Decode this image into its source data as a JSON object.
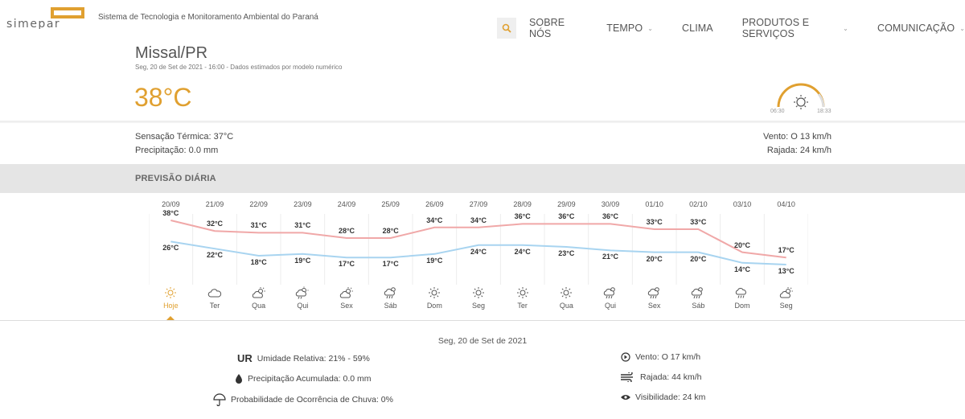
{
  "header": {
    "logo_text": "simepar",
    "subtitle": "Sistema de Tecnologia e Monitoramento Ambiental do Paraná",
    "accent": "#e0a030",
    "nav": [
      {
        "label": "SOBRE NÓS",
        "dropdown": false
      },
      {
        "label": "TEMPO",
        "dropdown": true
      },
      {
        "label": "CLIMA",
        "dropdown": false
      },
      {
        "label": "PRODUTOS E SERVIÇOS",
        "dropdown": true
      },
      {
        "label": "COMUNICAÇÃO",
        "dropdown": true
      }
    ]
  },
  "location": {
    "city": "Missal/PR",
    "subline": "Seg, 20 de Set de 2021 - 16:00 - Dados estimados por modelo numérico",
    "temperature": "38°C",
    "sunrise": "06:30",
    "sunset": "18:33"
  },
  "details": {
    "feels_like": "Sensação Térmica: 37°C",
    "precipitation": "Precipitação: 0.0 mm",
    "wind": "Vento: O 13 km/h",
    "gust": "Rajada: 24 km/h"
  },
  "section_title": "PREVISÃO DIÁRIA",
  "chart_data": {
    "type": "line",
    "dates": [
      "20/09",
      "21/09",
      "22/09",
      "23/09",
      "24/09",
      "25/09",
      "26/09",
      "27/09",
      "28/09",
      "29/09",
      "30/09",
      "01/10",
      "02/10",
      "03/10",
      "04/10"
    ],
    "weekdays": [
      "Hoje",
      "Ter",
      "Qua",
      "Qui",
      "Sex",
      "Sáb",
      "Dom",
      "Seg",
      "Ter",
      "Qua",
      "Qui",
      "Sex",
      "Sáb",
      "Dom",
      "Seg"
    ],
    "icons": [
      "sun-icon",
      "cloud-icon",
      "partly-cloudy-icon",
      "partly-cloudy-rain-icon",
      "partly-cloudy-icon",
      "rain-storm-icon",
      "sun-icon",
      "sun-icon",
      "sun-icon",
      "sun-icon",
      "rain-storm-icon",
      "rain-storm-icon",
      "rain-storm-icon",
      "rain-icon",
      "partly-cloudy-icon"
    ],
    "series": [
      {
        "name": "max",
        "color": "#f0a8a8",
        "values": [
          38,
          32,
          31,
          31,
          28,
          28,
          34,
          34,
          36,
          36,
          36,
          33,
          33,
          20,
          17
        ],
        "labels": [
          "38°C",
          "32°C",
          "31°C",
          "31°C",
          "28°C",
          "28°C",
          "34°C",
          "34°C",
          "36°C",
          "36°C",
          "36°C",
          "33°C",
          "33°C",
          "20°C",
          "17°C"
        ]
      },
      {
        "name": "min",
        "color": "#a8d4f0",
        "values": [
          26,
          22,
          18,
          19,
          17,
          17,
          19,
          24,
          24,
          23,
          21,
          20,
          20,
          14,
          13
        ],
        "labels": [
          "26°C",
          "22°C",
          "18°C",
          "19°C",
          "17°C",
          "17°C",
          "19°C",
          "24°C",
          "24°C",
          "23°C",
          "21°C",
          "20°C",
          "20°C",
          "14°C",
          "13°C"
        ]
      }
    ],
    "active_index": 0
  },
  "day_detail": {
    "date": "Seg, 20 de Set de 2021",
    "ur_abbr": "UR",
    "humidity": "Umidade Relativa: 21% - 59%",
    "accum_precip": "Precipitação Acumulada: 0.0 mm",
    "rain_prob": "Probabilidade de Ocorrência de Chuva: 0%",
    "wind": "Vento: O 17 km/h",
    "gust": "Rajada: 44 km/h",
    "visibility": "Visibilidade: 24 km"
  }
}
